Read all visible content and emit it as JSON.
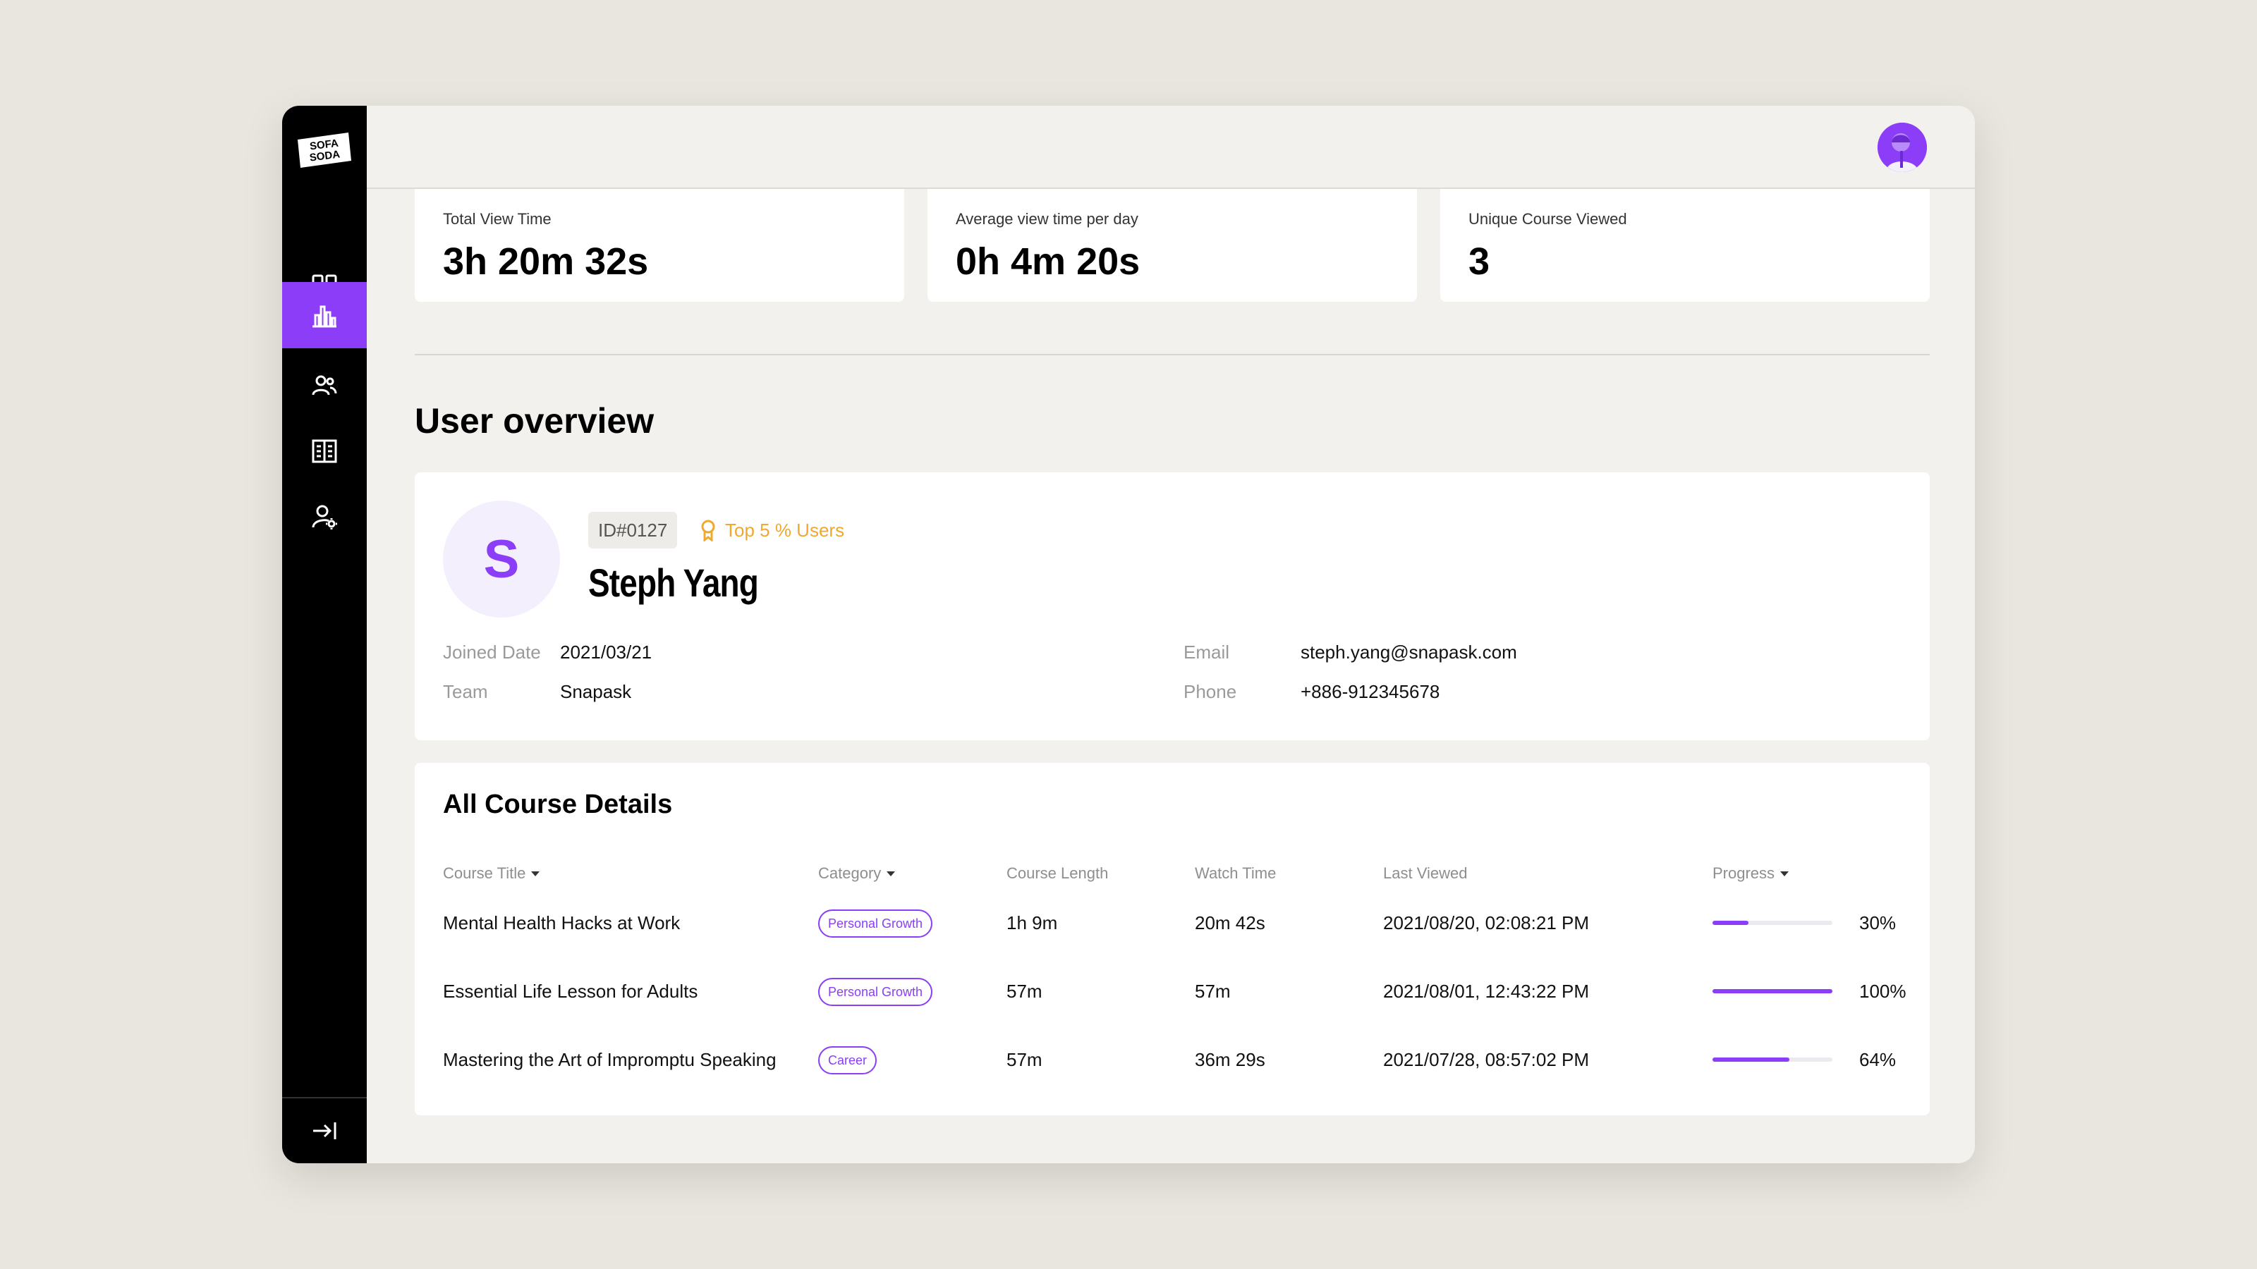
{
  "brand": {
    "logo_text_line1": "SOFA",
    "logo_text_line2": "SODA",
    "accent_color": "#8B3DF7",
    "sidebar_color": "#000000"
  },
  "sidebar": {
    "items": [
      {
        "icon": "dashboard-grid-icon",
        "active": false
      },
      {
        "icon": "bar-chart-icon",
        "active": true
      },
      {
        "icon": "users-icon",
        "active": false
      },
      {
        "icon": "book-icon",
        "active": false
      },
      {
        "icon": "user-settings-icon",
        "active": false
      }
    ],
    "collapse_icon": "collapse-arrow-icon"
  },
  "header": {
    "avatar_icon": "user-avatar-icon"
  },
  "stats": [
    {
      "label": "Total View Time",
      "value": "3h 20m 32s"
    },
    {
      "label": "Average view time per day",
      "value": "0h 4m 20s"
    },
    {
      "label": "Unique Course Viewed",
      "value": "3"
    }
  ],
  "user_overview": {
    "title": "User overview",
    "initial": "S",
    "id": "ID#0127",
    "badge": "Top 5 % Users",
    "badge_color": "#F0A82E",
    "name": "Steph Yang",
    "fields": {
      "joined_label": "Joined Date",
      "joined_value": "2021/03/21",
      "team_label": "Team",
      "team_value": "Snapask",
      "email_label": "Email",
      "email_value": "steph.yang@snapask.com",
      "phone_label": "Phone",
      "phone_value": "+886-912345678"
    }
  },
  "courses": {
    "title": "All Course Details",
    "columns": {
      "title": "Course Title",
      "category": "Category",
      "length": "Course Length",
      "watch": "Watch Time",
      "last": "Last Viewed",
      "progress": "Progress"
    },
    "rows": [
      {
        "title": "Mental Health Hacks at Work",
        "category": "Personal Growth",
        "length": "1h 9m",
        "watch": "20m 42s",
        "last": "2021/08/20, 02:08:21 PM",
        "progress": 30,
        "progress_label": "30%"
      },
      {
        "title": "Essential Life Lesson for Adults",
        "category": "Personal Growth",
        "length": "57m",
        "watch": "57m",
        "last": "2021/08/01, 12:43:22 PM",
        "progress": 100,
        "progress_label": "100%"
      },
      {
        "title": "Mastering the Art of Impromptu Speaking",
        "category": "Career",
        "length": "57m",
        "watch": "36m 29s",
        "last": "2021/07/28, 08:57:02 PM",
        "progress": 64,
        "progress_label": "64%"
      }
    ]
  }
}
